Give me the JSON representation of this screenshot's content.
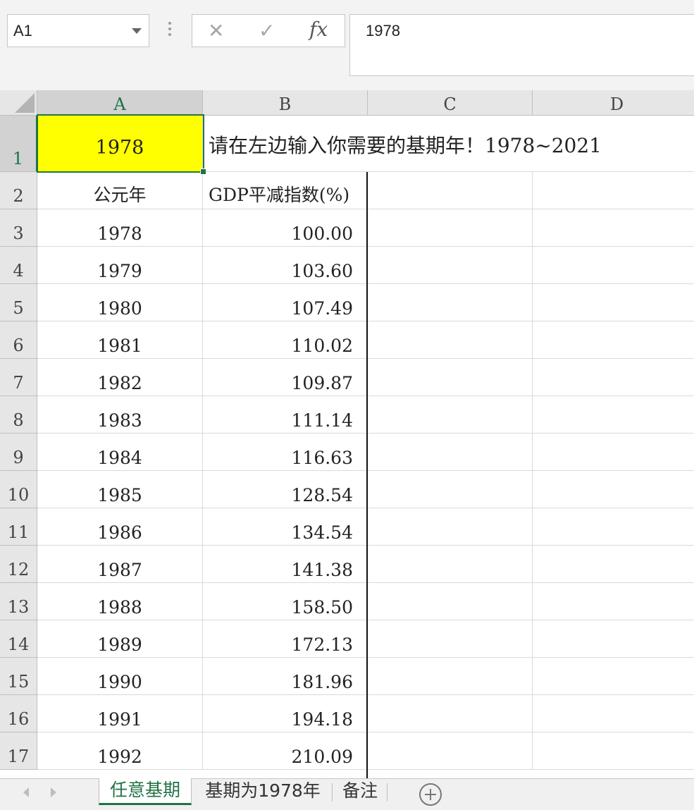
{
  "formula_bar": {
    "name_box": "A1",
    "cancel_icon": "✕",
    "enter_icon": "✓",
    "fx_label": "fx",
    "formula": "1978"
  },
  "columns": [
    "A",
    "B",
    "C",
    "D"
  ],
  "rows": [
    "1",
    "2",
    "3",
    "4",
    "5",
    "6",
    "7",
    "8",
    "9",
    "10",
    "11",
    "12",
    "13",
    "14",
    "15",
    "16",
    "17"
  ],
  "cells": {
    "a1": "1978",
    "b1": "请在左边输入你需要的基期年！1978~2021",
    "a2": "公元年",
    "b2": "GDP平减指数(%)"
  },
  "data_rows": [
    {
      "year": "1978",
      "gdp": "100.00"
    },
    {
      "year": "1979",
      "gdp": "103.60"
    },
    {
      "year": "1980",
      "gdp": "107.49"
    },
    {
      "year": "1981",
      "gdp": "110.02"
    },
    {
      "year": "1982",
      "gdp": "109.87"
    },
    {
      "year": "1983",
      "gdp": "111.14"
    },
    {
      "year": "1984",
      "gdp": "116.63"
    },
    {
      "year": "1985",
      "gdp": "128.54"
    },
    {
      "year": "1986",
      "gdp": "134.54"
    },
    {
      "year": "1987",
      "gdp": "141.38"
    },
    {
      "year": "1988",
      "gdp": "158.50"
    },
    {
      "year": "1989",
      "gdp": "172.13"
    },
    {
      "year": "1990",
      "gdp": "181.96"
    },
    {
      "year": "1991",
      "gdp": "194.18"
    },
    {
      "year": "1992",
      "gdp": "210.09"
    }
  ],
  "selected_cell_fill": "#ffff00",
  "accent_color": "#217346",
  "sheet_tabs": [
    {
      "label": "任意基期",
      "active": true
    },
    {
      "label": "基期为1978年",
      "active": false
    },
    {
      "label": "备注",
      "active": false
    }
  ],
  "icons": {
    "prev_sheet": "chevron-left-icon",
    "next_sheet": "chevron-right-icon",
    "add_sheet": "plus-circle-icon"
  }
}
